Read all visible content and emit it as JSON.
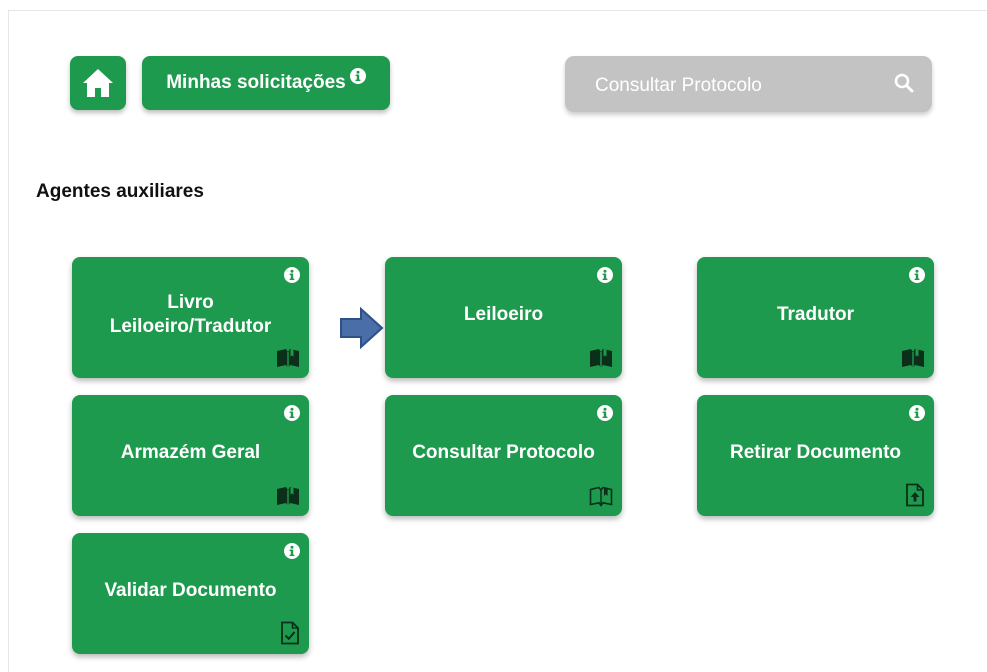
{
  "header": {
    "home_icon": "home-icon",
    "minhas_label": "Minhas solicitações",
    "search_placeholder": "Consultar Protocolo",
    "search_icon": "search-icon"
  },
  "section": {
    "title": "Agentes auxiliares"
  },
  "cards": [
    {
      "label_line1": "Livro",
      "label_line2": "Leiloeiro/Tradutor",
      "icon": "book-icon"
    },
    {
      "label": "Leiloeiro",
      "icon": "book-icon"
    },
    {
      "label": "Tradutor",
      "icon": "book-icon"
    },
    {
      "label": "Armazém Geral",
      "icon": "book-icon"
    },
    {
      "label": "Consultar Protocolo",
      "icon": "book-open-outline-icon"
    },
    {
      "label": "Retirar Documento",
      "icon": "file-upload-icon"
    },
    {
      "label": "Validar Documento",
      "icon": "file-check-icon"
    }
  ],
  "colors": {
    "primary_green": "#1e9a4e",
    "search_gray": "#c3c3c3",
    "arrow_blue": "#4a6fa8"
  }
}
